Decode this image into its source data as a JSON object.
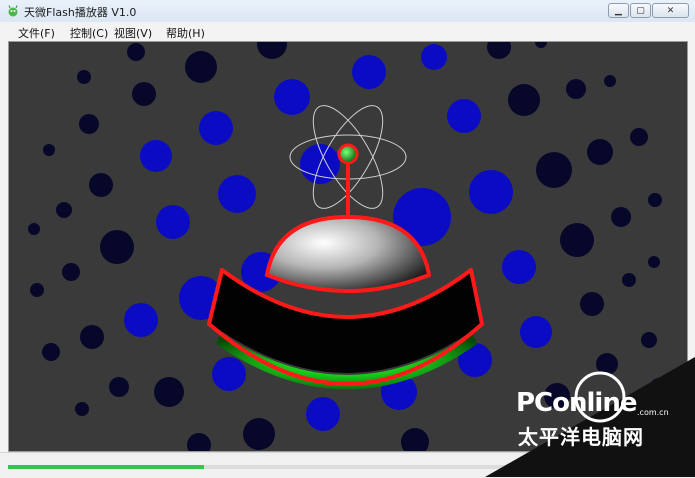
{
  "window": {
    "title": "天微Flash播放器 V1.0",
    "buttons": [
      "minimize",
      "maximize",
      "close"
    ]
  },
  "menu": {
    "items": [
      {
        "label": "文件(F)"
      },
      {
        "label": "控制(C)"
      },
      {
        "label": "视图(V)"
      },
      {
        "label": "帮助(H)"
      }
    ]
  },
  "stage": {
    "content": "flash-animation",
    "colors": {
      "background": "#3a3a3a",
      "dot_dark": "#0a0a32",
      "dot_blue": "#0808c8",
      "saucer_outline": "#ff2020",
      "saucer_glow": "#10e020"
    }
  },
  "status": {
    "progress": 0.35
  },
  "watermark": {
    "brand": "PConline",
    "domain": ".com.cn",
    "tagline": "太平洋电脑网"
  }
}
